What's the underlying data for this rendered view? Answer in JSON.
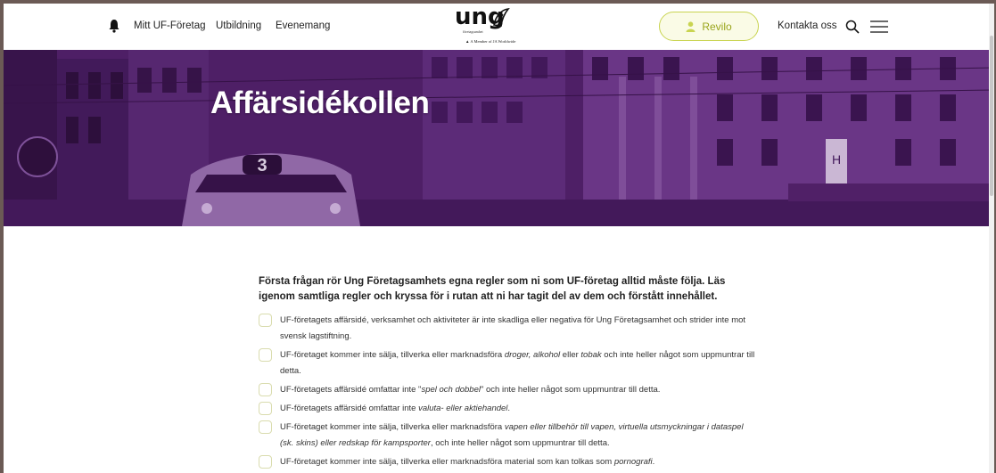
{
  "header": {
    "nav": [
      "Mitt UF-Företag",
      "Utbildning",
      "Evenemang"
    ],
    "logo": {
      "word": "ung",
      "sub": "företagsamhet",
      "tagline": "▲ A Member of JA Worldwide"
    },
    "user_button": "Revilo",
    "contact": "Kontakta oss",
    "accent_color": "#c9d451"
  },
  "hero": {
    "title": "Affärsidékollen",
    "tram_number": "3",
    "sign_letter": "H",
    "overlay_color": "#5b2a78"
  },
  "content": {
    "intro": "Första frågan rör Ung Företagsamhets egna regler som ni som UF-företag alltid måste följa. Läs igenom samtliga regler och kryssa för i rutan att ni har tagit del av dem och förstått innehållet.",
    "rules": [
      {
        "segments": [
          {
            "t": "UF-företagets affärsidé, verksamhet och aktiviteter är inte skadliga eller negativa för Ung Företagsamhet och strider inte mot svensk lagstiftning.",
            "i": false
          }
        ]
      },
      {
        "segments": [
          {
            "t": "UF-företaget kommer inte sälja, tillverka eller marknadsföra ",
            "i": false
          },
          {
            "t": "droger, alkohol",
            "i": true
          },
          {
            "t": " eller ",
            "i": false
          },
          {
            "t": "tobak",
            "i": true
          },
          {
            "t": " och inte heller något som uppmuntrar till detta.",
            "i": false
          }
        ]
      },
      {
        "segments": [
          {
            "t": "UF-företagets affärsidé omfattar inte \"",
            "i": false
          },
          {
            "t": "spel och dobbel",
            "i": true
          },
          {
            "t": "\" och inte heller något som uppmuntrar till detta.",
            "i": false
          }
        ]
      },
      {
        "segments": [
          {
            "t": "UF-företagets affärsidé omfattar inte ",
            "i": false
          },
          {
            "t": "valuta- eller aktiehandel",
            "i": true
          },
          {
            "t": ".",
            "i": false
          }
        ]
      },
      {
        "segments": [
          {
            "t": "UF-företaget kommer inte sälja, tillverka eller marknadsföra ",
            "i": false
          },
          {
            "t": "vapen eller tillbehör till vapen, virtuella utsmyckningar i dataspel (sk. skins) eller redskap för kampsporter",
            "i": true
          },
          {
            "t": ", och inte heller något som uppmuntrar till detta.",
            "i": false
          }
        ]
      },
      {
        "segments": [
          {
            "t": "UF-företaget kommer inte sälja, tillverka eller marknadsföra material som kan tolkas som ",
            "i": false
          },
          {
            "t": "pornografi",
            "i": true
          },
          {
            "t": ".",
            "i": false
          }
        ]
      }
    ]
  }
}
